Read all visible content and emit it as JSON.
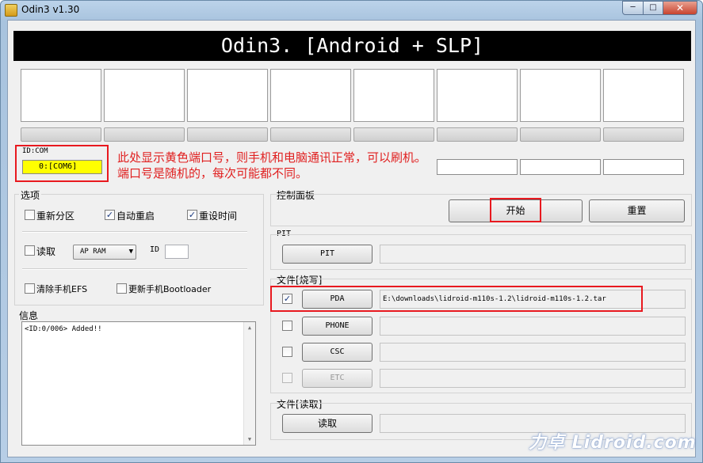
{
  "window": {
    "title": "Odin3 v1.30",
    "min": "─",
    "max": "□",
    "close": "✕"
  },
  "banner": "Odin3. [Android + SLP]",
  "id_com": {
    "label": "ID:COM",
    "port": "0:[COM6]"
  },
  "annotation": {
    "line1": "此处显示黄色端口号，则手机和电脑通讯正常，可以刷机。",
    "line2": "端口号是随机的，每次可能都不同。"
  },
  "options": {
    "title": "选项",
    "repartition": {
      "label": "重新分区",
      "checked": false
    },
    "auto_reboot": {
      "label": "自动重启",
      "checked": true
    },
    "reset_time": {
      "label": "重设时间",
      "checked": true
    },
    "read": {
      "label": "读取",
      "checked": false
    },
    "ap_select": "AP RAM",
    "id_label": "ID",
    "clear_efs": {
      "label": "清除手机EFS",
      "checked": false
    },
    "update_bootloader": {
      "label": "更新手机Bootloader",
      "checked": false
    }
  },
  "info": {
    "title": "信息",
    "log": "<ID:0/006> Added!!"
  },
  "control": {
    "title": "控制面板",
    "start": "开始",
    "reset": "重置"
  },
  "pit": {
    "title": "PIT",
    "button": "PIT",
    "path": ""
  },
  "files": {
    "title": "文件[烧写]",
    "rows": [
      {
        "label": "PDA",
        "checked": true,
        "path": "E:\\downloads\\lidroid-m110s-1.2\\lidroid-m110s-1.2.tar"
      },
      {
        "label": "PHONE",
        "checked": false,
        "path": ""
      },
      {
        "label": "CSC",
        "checked": false,
        "path": ""
      },
      {
        "label": "ETC",
        "checked": false,
        "path": ""
      }
    ]
  },
  "file_read": {
    "title": "文件[读取]",
    "button": "读取",
    "path": ""
  },
  "watermark": "力卓 Lidroid.com",
  "colors": {
    "com_highlight": "#ffff00",
    "annotation_red": "#e8191f",
    "banner_bg": "#000000"
  }
}
